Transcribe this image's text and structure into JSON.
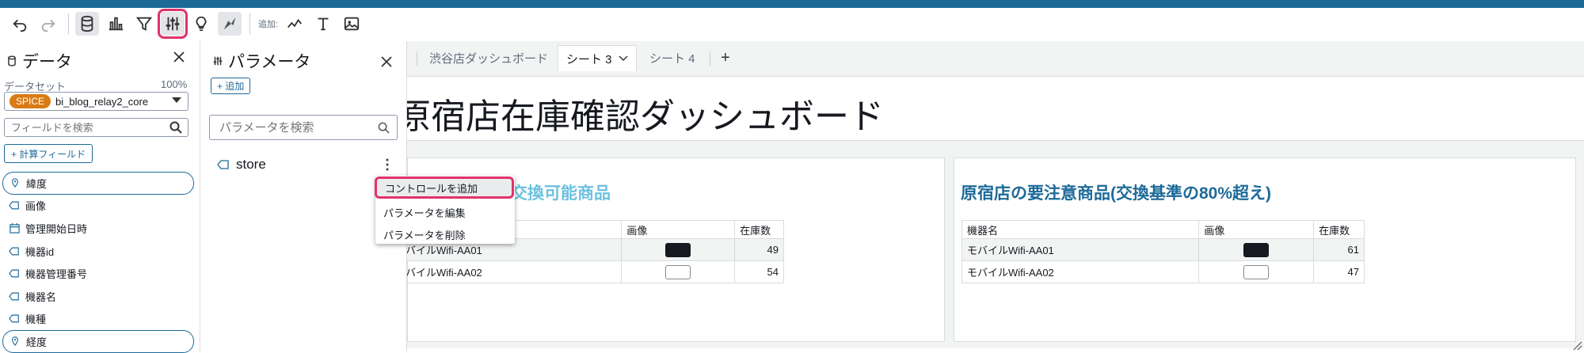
{
  "toolbar": {
    "add_label": "追加:"
  },
  "data_panel": {
    "title": "データ",
    "dataset_label": "データセット",
    "dataset_pct": "100%",
    "spice_badge": "SPICE",
    "dataset_name": "bi_blog_relay2_core",
    "field_search_placeholder": "フィールドを検索",
    "calc_field_label": "+ 計算フィールド",
    "fields": [
      {
        "label": "緯度",
        "type": "geo"
      },
      {
        "label": "画像",
        "type": "string"
      },
      {
        "label": "管理開始日時",
        "type": "date"
      },
      {
        "label": "機器id",
        "type": "string"
      },
      {
        "label": "機器管理番号",
        "type": "string"
      },
      {
        "label": "機器名",
        "type": "string"
      },
      {
        "label": "機種",
        "type": "string"
      },
      {
        "label": "経度",
        "type": "geo"
      }
    ]
  },
  "param_panel": {
    "title": "パラメータ",
    "add_label": "+ 追加",
    "search_placeholder": "パラメータを検索",
    "params": [
      {
        "name": "store"
      }
    ]
  },
  "context_menu": {
    "items": [
      "コントロールを追加",
      "パラメータを編集",
      "パラメータを削除"
    ]
  },
  "tabs": {
    "items": [
      "渋谷店ダッシュボード",
      "シート 3",
      "シート 4"
    ],
    "add": "+"
  },
  "dashboard": {
    "title": "原宿店在庫確認ダッシュボード",
    "visual1": {
      "title": "交換可能商品",
      "headers": [
        "",
        "画像",
        "在庫数"
      ],
      "rows": [
        {
          "name": "バイルWifi-AA01",
          "stock": "49"
        },
        {
          "name": "バイルWifi-AA02",
          "stock": "54"
        }
      ]
    },
    "visual2": {
      "title": "原宿店の要注意商品(交換基準の80%超え)",
      "headers": [
        "機器名",
        "画像",
        "在庫数"
      ],
      "rows": [
        {
          "name": "モバイルWifi-AA01",
          "stock": "61"
        },
        {
          "name": "モバイルWifi-AA02",
          "stock": "47"
        }
      ]
    }
  },
  "colors": {
    "accent": "#1d6a99",
    "highlight": "#e0336b",
    "spice": "#d97b14",
    "visual_title_light": "#6cc1e0"
  }
}
